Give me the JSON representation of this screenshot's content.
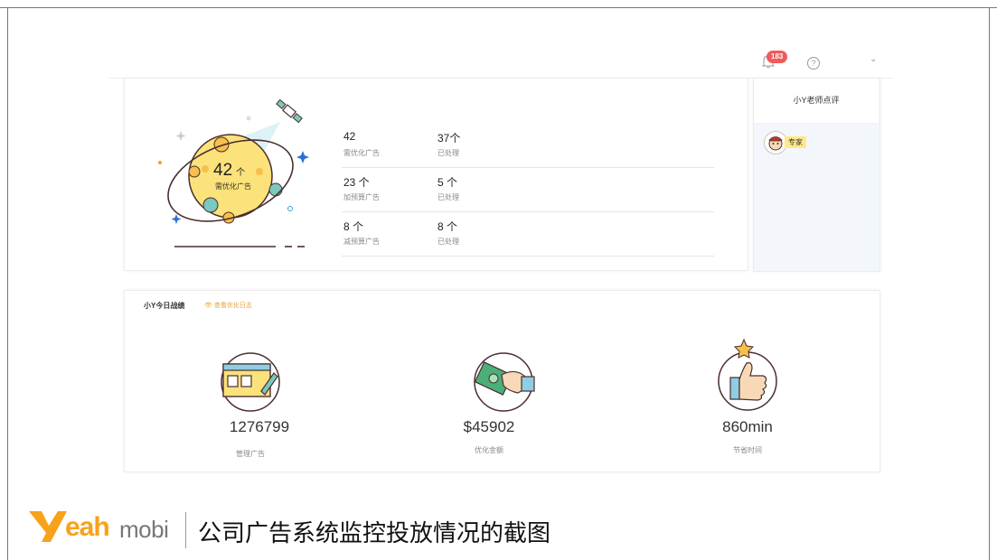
{
  "header": {
    "notification_count": "183",
    "help_glyph": "?",
    "dropdown_glyph": "⌄"
  },
  "overview": {
    "planet_value": "42",
    "planet_unit": "个",
    "planet_label": "需优化广告",
    "rows": [
      {
        "value": "42",
        "label": "需优化广告",
        "processed_value": "37个",
        "processed_label": "已处理"
      },
      {
        "value": "23 个",
        "label": "加预算广告",
        "processed_value": "5 个",
        "processed_label": "已处理"
      },
      {
        "value": "8 个",
        "label": "减预算广告",
        "processed_value": "8 个",
        "processed_label": "已处理"
      }
    ]
  },
  "side_panel": {
    "title": "小Y老师点评",
    "expert_tag": "专家"
  },
  "daily": {
    "title": "小Y今日战绩",
    "link_label": "查看优化日志",
    "stats": [
      {
        "value": "1276799",
        "label": "管理广告",
        "icon": "ad-board-icon"
      },
      {
        "value": "$45902",
        "label": "优化金额",
        "icon": "money-hand-icon"
      },
      {
        "value": "860min",
        "label": "节省时间",
        "icon": "thumbs-up-icon"
      }
    ]
  },
  "footer": {
    "logo_main": "eah",
    "logo_suffix": "mobi",
    "caption": "公司广告系统监控投放情况的截图"
  },
  "colors": {
    "accent_orange": "#f7a21b",
    "badge_red": "#f25a5a",
    "planet_yellow": "#fbe27a"
  }
}
